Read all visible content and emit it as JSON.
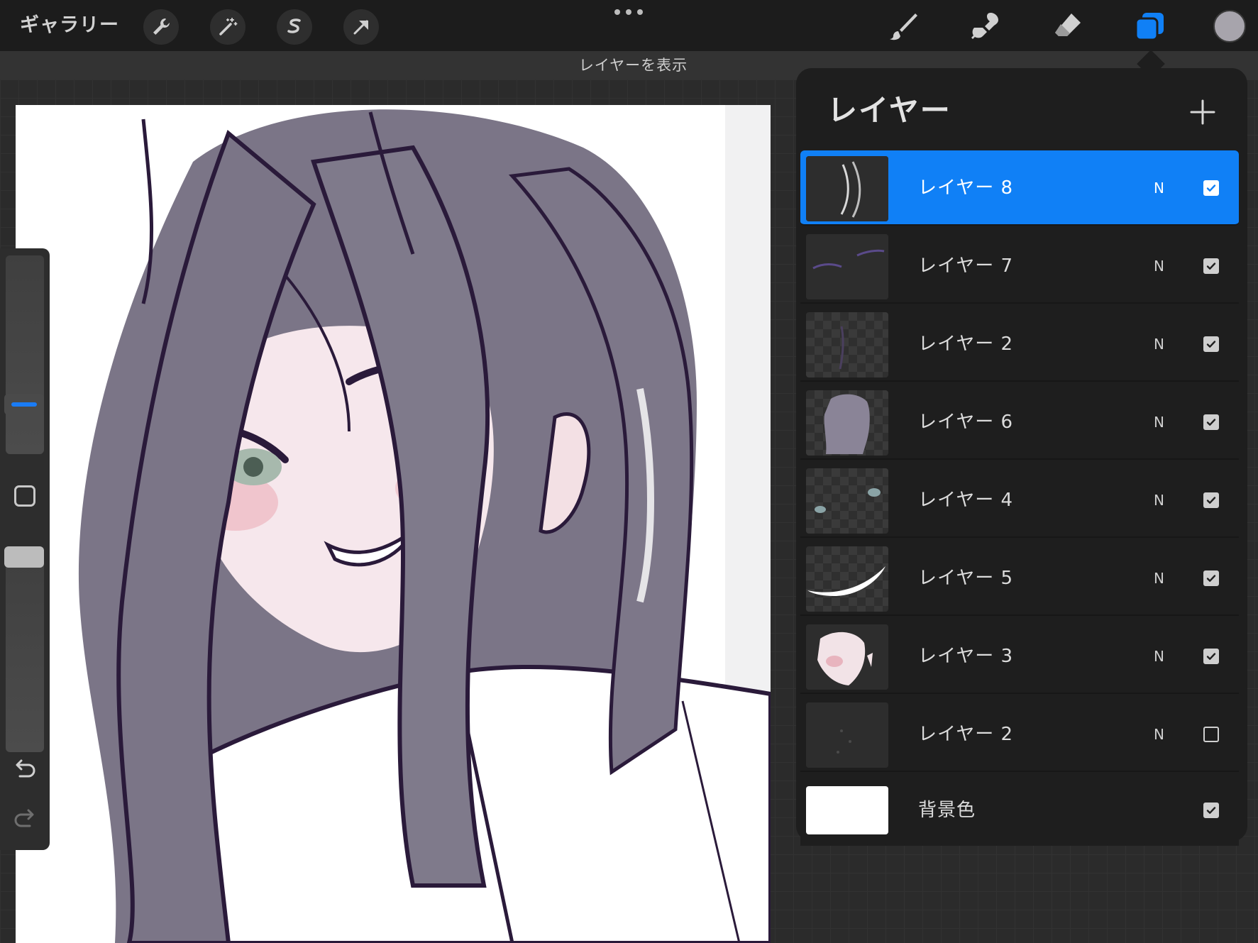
{
  "toolbar": {
    "gallery_label": "ギャラリー",
    "left_tools": [
      {
        "icon": "wrench-icon"
      },
      {
        "icon": "magic-wand-icon"
      },
      {
        "icon": "selection-icon"
      },
      {
        "icon": "transform-arrow-icon"
      }
    ],
    "right_tools": [
      {
        "icon": "brush-icon"
      },
      {
        "icon": "smudge-icon"
      },
      {
        "icon": "eraser-icon"
      },
      {
        "icon": "layers-icon",
        "active": true
      }
    ],
    "current_color": "#a7a4ac",
    "accent_color": "#1080f6"
  },
  "status_strip": {
    "text": "レイヤーを表示"
  },
  "layers_panel": {
    "title": "レイヤー",
    "add_icon": "plus-icon",
    "layers": [
      {
        "name": "レイヤー 8",
        "blend": "N",
        "visible": true,
        "active": true
      },
      {
        "name": "レイヤー 7",
        "blend": "N",
        "visible": true,
        "active": false
      },
      {
        "name": "レイヤー 2",
        "blend": "N",
        "visible": true,
        "active": false
      },
      {
        "name": "レイヤー 6",
        "blend": "N",
        "visible": true,
        "active": false
      },
      {
        "name": "レイヤー 4",
        "blend": "N",
        "visible": true,
        "active": false
      },
      {
        "name": "レイヤー 5",
        "blend": "N",
        "visible": true,
        "active": false
      },
      {
        "name": "レイヤー 3",
        "blend": "N",
        "visible": true,
        "active": false
      },
      {
        "name": "レイヤー 2",
        "blend": "N",
        "visible": false,
        "active": false
      },
      {
        "name": "背景色",
        "blend": "",
        "visible": true,
        "active": false
      }
    ]
  },
  "sidebar": {
    "brush_size": 0.22,
    "brush_opacity": 1.0,
    "undo_icon": "undo-icon",
    "redo_icon": "redo-icon",
    "modify_icon": "modify-square-icon"
  }
}
